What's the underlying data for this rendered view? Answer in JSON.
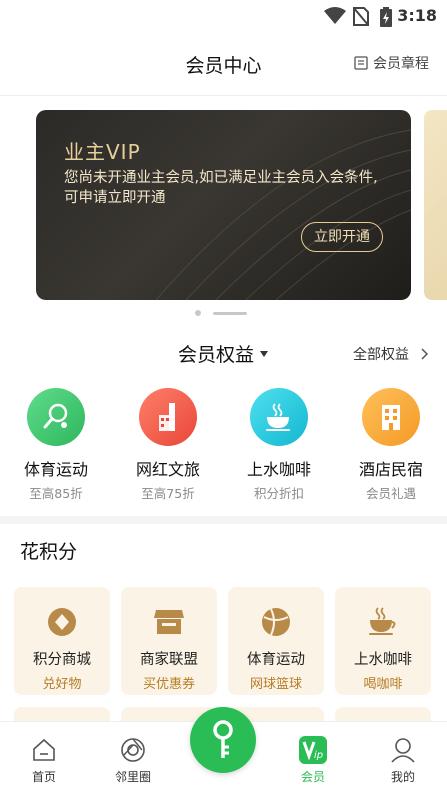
{
  "status_bar": {
    "time": "3:18",
    "icons": [
      "wifi-icon",
      "no-sim-icon",
      "battery-charging-icon"
    ]
  },
  "header": {
    "title": "会员中心",
    "rules_label": "会员章程",
    "rules_icon": "document-icon"
  },
  "banner": {
    "badge": "业主VIP",
    "description": "您尚未开通业主会员,如已满足业主会员入会条件,可申请立即开通",
    "button_label": "立即开通",
    "gold_color": "#e6cf9a"
  },
  "benefits": {
    "title": "会员权益",
    "all_label": "全部权益",
    "items": [
      {
        "name": "体育运动",
        "sub": "至高85折",
        "icon": "tennis-icon",
        "color": "#38c66b"
      },
      {
        "name": "网红文旅",
        "sub": "至高75折",
        "icon": "landmark-icon",
        "color": "#f15b4b"
      },
      {
        "name": "上水咖啡",
        "sub": "积分折扣",
        "icon": "coffee-icon",
        "color": "#1fc6dc"
      },
      {
        "name": "酒店民宿",
        "sub": "会员礼遇",
        "icon": "hotel-icon",
        "color": "#f6a32f"
      }
    ]
  },
  "points": {
    "title": "花积分",
    "cards": [
      {
        "name": "积分商城",
        "sub": "兑好物",
        "icon": "diamond-icon"
      },
      {
        "name": "商家联盟",
        "sub": "买优惠券",
        "icon": "store-icon"
      },
      {
        "name": "体育运动",
        "sub": "网球篮球",
        "icon": "ball-icon"
      },
      {
        "name": "上水咖啡",
        "sub": "喝咖啡",
        "icon": "coffee-cup-icon"
      }
    ]
  },
  "bottom_nav": {
    "items": [
      {
        "label": "首页",
        "icon": "home-icon"
      },
      {
        "label": "邻里圈",
        "icon": "circle-icon"
      },
      {
        "label": "会员",
        "icon": "vip-icon",
        "active": true
      },
      {
        "label": "我的",
        "icon": "profile-icon"
      }
    ],
    "center_icon": "key-icon",
    "accent": "#2bbd55"
  }
}
